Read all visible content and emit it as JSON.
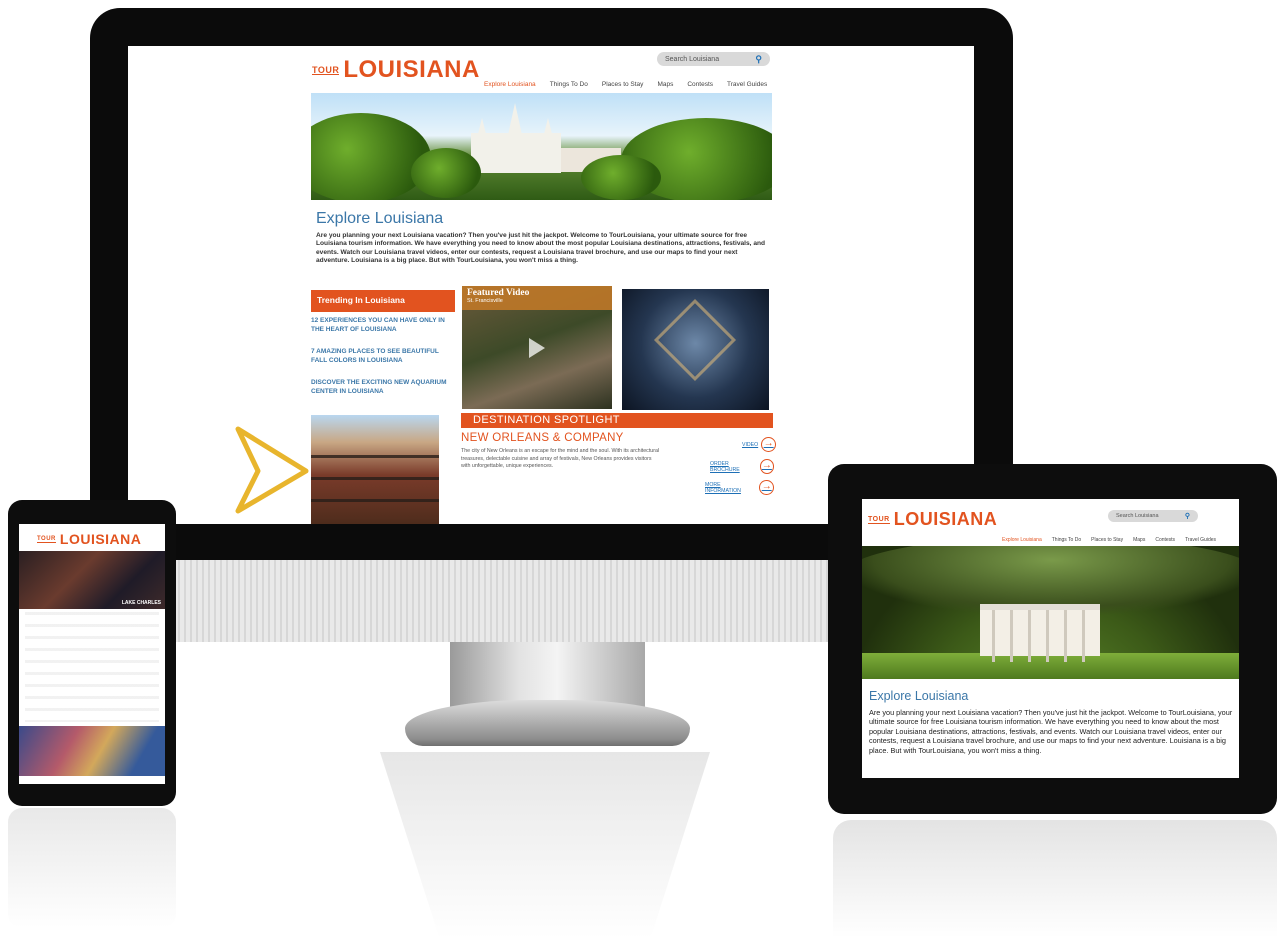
{
  "brand": {
    "tour": "TOUR",
    "name": "LOUISIANA"
  },
  "colors": {
    "accent": "#e2531f",
    "link": "#3b77a8",
    "search_icon": "#1d6fb6"
  },
  "search": {
    "placeholder": "Search Louisiana"
  },
  "nav": [
    "Explore Louisiana",
    "Things To Do",
    "Places to Stay",
    "Maps",
    "Contests",
    "Travel Guides"
  ],
  "explore": {
    "title": "Explore Louisiana",
    "text": "Are you planning your next Louisiana vacation? Then you've just hit the jackpot. Welcome to TourLouisiana, your ultimate source for free Louisiana tourism information. We have everything you need to know about the most popular Louisiana destinations, attractions, festivals, and events. Watch our Louisiana travel videos, enter our contests, request a Louisiana travel brochure, and use our maps to find your next adventure. Louisiana is a big place. But with TourLouisiana, you won't miss a thing."
  },
  "trending": {
    "heading": "Trending In Louisiana",
    "items": [
      "12 EXPERIENCES YOU CAN HAVE ONLY IN THE HEART OF LOUISIANA",
      "7 AMAZING PLACES TO SEE BEAUTIFUL FALL COLORS IN LOUISIANA",
      "DISCOVER THE EXCITING NEW AQUARIUM CENTER IN LOUISIANA"
    ]
  },
  "featured_video": {
    "title": "Featured Video",
    "location": "St. Francisville",
    "icon": "play-icon"
  },
  "spotlight": {
    "heading": "DESTINATION SPOTLIGHT",
    "title": "NEW ORLEANS & COMPANY",
    "text": "The city of New Orleans is an escape for the mind and the soul. With its architectural treasures, delectable cuisine and array of festivals, New Orleans provides visitors with unforgettable, unique experiences.",
    "links": [
      "VIDEO",
      "ORDER BROCHURE",
      "MORE INFORMATION"
    ]
  },
  "phone": {
    "caption": "LAKE CHARLES"
  }
}
